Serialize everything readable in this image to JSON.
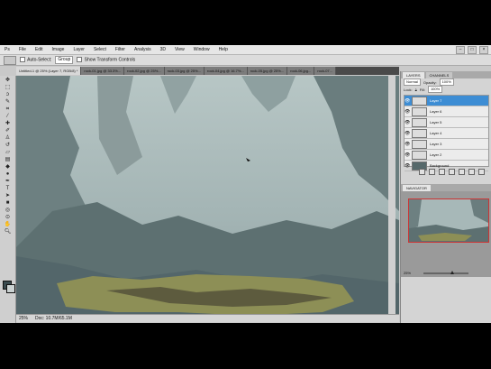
{
  "menu": [
    "Ps",
    "File",
    "Edit",
    "Image",
    "Layer",
    "Select",
    "Filter",
    "Analysis",
    "3D",
    "View",
    "Window",
    "Help"
  ],
  "window_controls": [
    "–",
    "□",
    "×"
  ],
  "options": {
    "tool_preset": "",
    "auto_select_label": "Auto-Select:",
    "auto_select_value": "Group",
    "show_transform_label": "Show Transform Controls"
  },
  "tabs": [
    {
      "label": "Untitled-1 @ 25% (Layer 7, RGB/8) *",
      "active": true
    },
    {
      "label": "rock-01.jpg @ 33.3%...",
      "active": false
    },
    {
      "label": "rock-02.jpg @ 25%...",
      "active": false
    },
    {
      "label": "rock-03.jpg @ 25%...",
      "active": false
    },
    {
      "label": "rock-04.jpg @ 16.7%...",
      "active": false
    },
    {
      "label": "rock-05.jpg @ 25%...",
      "active": false
    },
    {
      "label": "rock-06.jpg...",
      "active": false
    },
    {
      "label": "rock-07...",
      "active": false
    }
  ],
  "status": {
    "zoom": "25%",
    "doc": "Doc: 10.7M/65.1M"
  },
  "layers_panel": {
    "tabs": [
      "LAYERS",
      "CHANNELS"
    ],
    "blend_mode": "Normal",
    "opacity_label": "Opacity:",
    "opacity": "100%",
    "lock_label": "Lock:",
    "fill_label": "Fill:",
    "fill": "100%",
    "layers": [
      {
        "name": "Layer 7",
        "selected": true
      },
      {
        "name": "Layer 6",
        "selected": false
      },
      {
        "name": "Layer 5",
        "selected": false
      },
      {
        "name": "Layer 4",
        "selected": false
      },
      {
        "name": "Layer 3",
        "selected": false
      },
      {
        "name": "Layer 2",
        "selected": false
      },
      {
        "name": "Background",
        "selected": false
      }
    ]
  },
  "navigator": {
    "tab": "NAVIGATOR",
    "zoom": "25%"
  },
  "colors": {
    "selected_layer": "#3d8dd4",
    "nav_frame": "#cc3333",
    "foreground": "#3a4b4f",
    "background": "#cbd2d2"
  }
}
